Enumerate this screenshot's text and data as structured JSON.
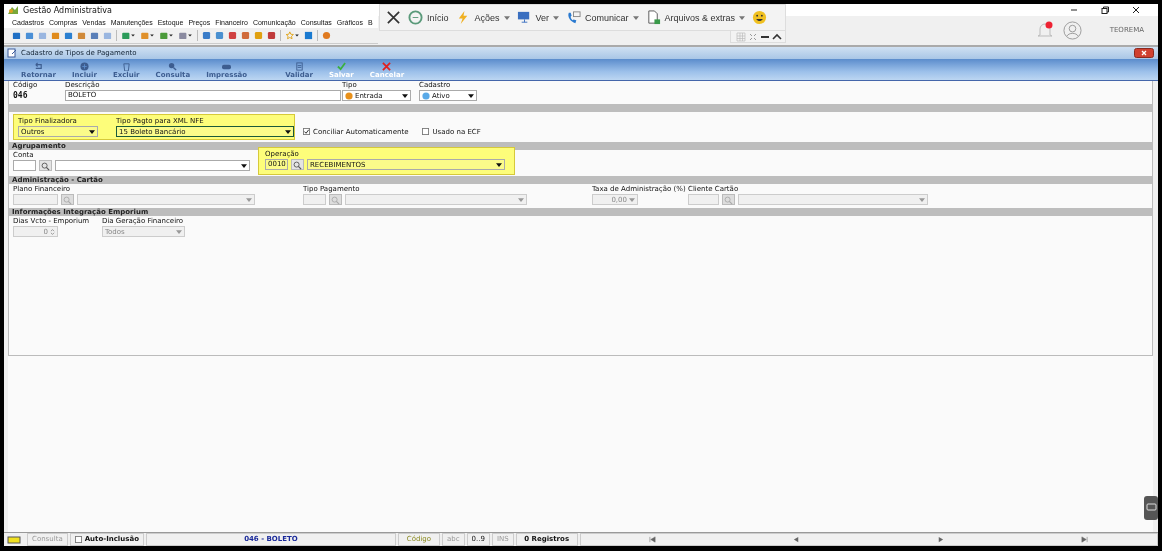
{
  "app": {
    "title": "Gestão Administrativa",
    "user": "TEOREMA"
  },
  "menu": [
    "Cadastros",
    "Compras",
    "Vendas",
    "Manutenções",
    "Estoque",
    "Preços",
    "Financeiro",
    "Comunicação",
    "Consultas",
    "Gráficos",
    "B"
  ],
  "remote_toolbar": [
    {
      "kind": "close",
      "dropdown": false
    },
    {
      "kind": "home",
      "label": "Início",
      "dropdown": false
    },
    {
      "kind": "bolt",
      "label": "Ações",
      "dropdown": true
    },
    {
      "kind": "monitor",
      "label": "Ver",
      "dropdown": true
    },
    {
      "kind": "chat",
      "label": "Comunicar",
      "dropdown": true
    },
    {
      "kind": "file",
      "label": "Arquivos & extras",
      "dropdown": true
    },
    {
      "kind": "smiley",
      "dropdown": false
    }
  ],
  "form": {
    "title": "Cadastro de Tipos de Pagamento",
    "toolbar": [
      {
        "kind": "back",
        "label": "Retornar",
        "disabled": true
      },
      {
        "kind": "add",
        "label": "Incluir",
        "disabled": true
      },
      {
        "kind": "trash",
        "label": "Excluir",
        "disabled": true
      },
      {
        "kind": "search",
        "label": "Consulta",
        "disabled": true
      },
      {
        "kind": "print",
        "label": "Impressão",
        "disabled": true
      },
      {
        "kind": "validate",
        "label": "Validar",
        "disabled": true
      },
      {
        "kind": "check",
        "label": "Salvar",
        "disabled": false
      },
      {
        "kind": "cross",
        "label": "Cancelar",
        "disabled": false
      }
    ],
    "codigo": {
      "label": "Código",
      "value": "046"
    },
    "descricao": {
      "label": "Descrição",
      "value": "BOLETO"
    },
    "tipo": {
      "label": "Tipo",
      "value": "Entrada"
    },
    "cadastro": {
      "label": "Cadastro",
      "value": "Ativo"
    },
    "finalizadora_group": {
      "highlighted": true,
      "tipo_finalizadora": {
        "label": "Tipo Finalizadora",
        "value": "Outros"
      },
      "tipo_pagto_xml": {
        "label": "Tipo Pagto para XML NFE",
        "value": "15 Boleto Bancário"
      }
    },
    "checkboxes": [
      {
        "label": "Conciliar Automaticamente",
        "checked": true
      },
      {
        "label": "Usado na ECF",
        "checked": false
      }
    ],
    "agrupamento": {
      "title": "Agrupamento",
      "conta": {
        "label": "Conta"
      },
      "operacao": {
        "label": "Operação",
        "code": "0010",
        "value": "RECEBIMENTOS",
        "highlighted": true
      }
    },
    "cartao": {
      "title": "Administração - Cartão",
      "plano_financeiro": {
        "label": "Plano Financeiro"
      },
      "tipo_pagamento": {
        "label": "Tipo Pagamento"
      },
      "taxa": {
        "label": "Taxa de Administração (%)",
        "value": "0,00"
      },
      "cliente": {
        "label": "Cliente Cartão"
      }
    },
    "emporium": {
      "title": "Informações Integração Emporium",
      "dias_vcto": {
        "label": "Dias Vcto - Emporium",
        "value": "0"
      },
      "dia_geracao": {
        "label": "Dia Geração Financeiro",
        "value": "Todos"
      }
    }
  },
  "status_bar": {
    "mode": "Consulta",
    "auto_inclusao": {
      "label": "Auto-Inclusão",
      "checked": false
    },
    "record": "046 - BOLETO",
    "key": "Código",
    "flags": [
      {
        "label": "abc",
        "disabled": true
      },
      {
        "label": "0..9",
        "disabled": false
      },
      {
        "label": "INS",
        "disabled": true
      }
    ],
    "count": "0 Registros"
  }
}
